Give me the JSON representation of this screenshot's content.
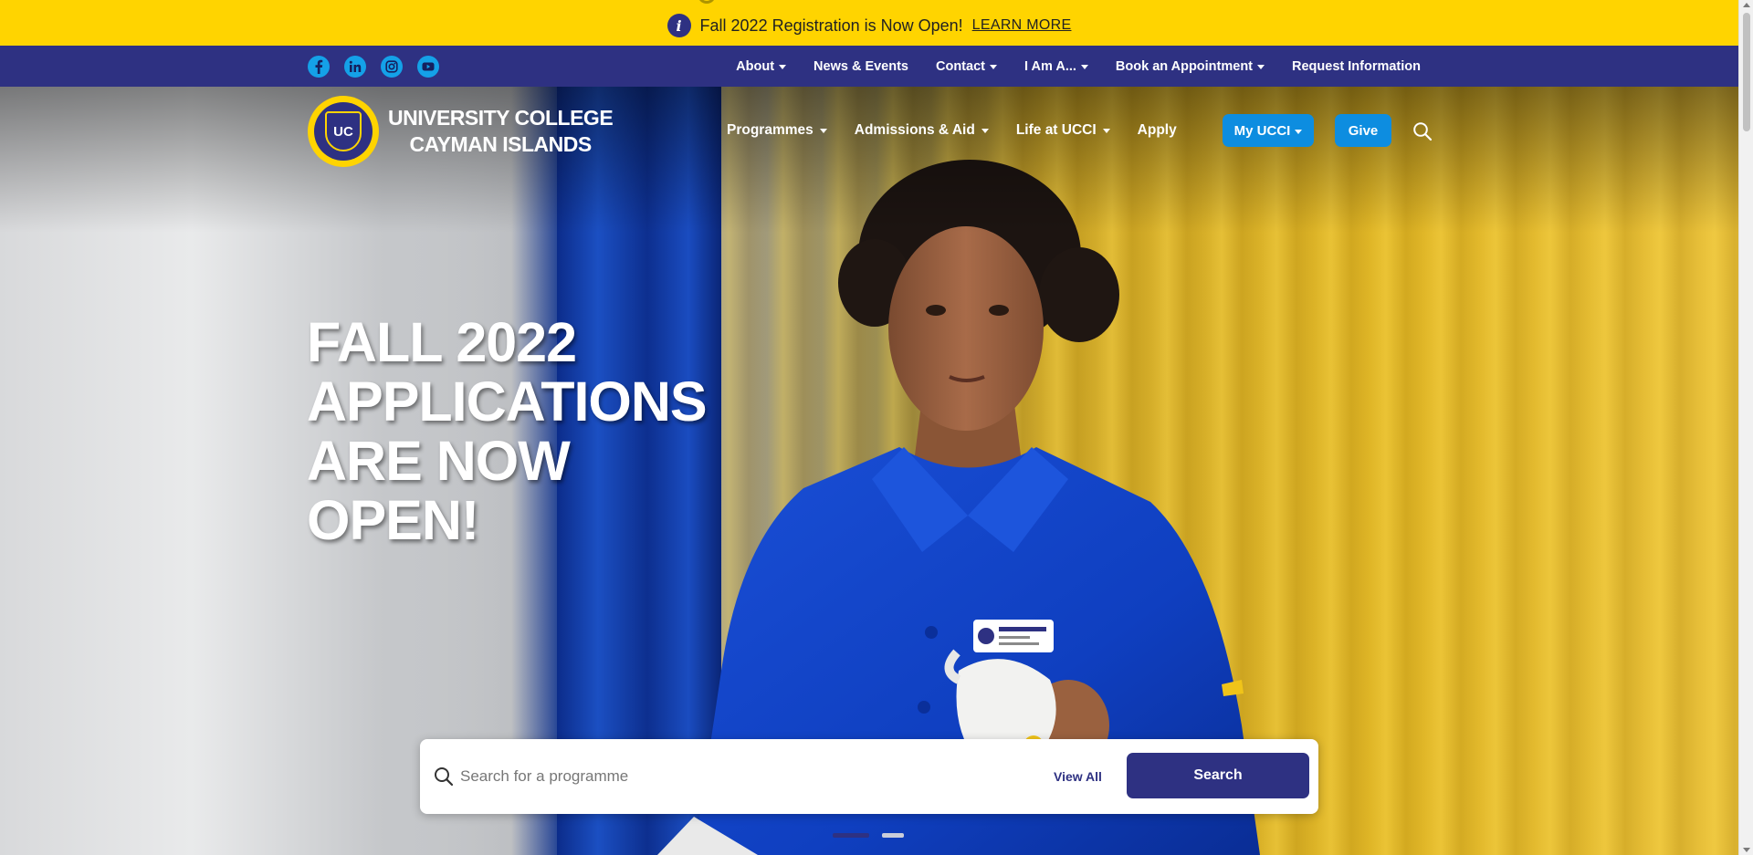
{
  "alert": {
    "icon": "info-icon",
    "text": "Fall 2022 Registration is Now Open!",
    "link": "LEARN MORE"
  },
  "social": [
    {
      "name": "facebook-icon",
      "glyph": "f"
    },
    {
      "name": "linkedin-icon",
      "glyph": "in"
    },
    {
      "name": "instagram-icon",
      "glyph": ""
    },
    {
      "name": "youtube-icon",
      "glyph": ""
    }
  ],
  "utility_nav": {
    "about": "About",
    "news": "News & Events",
    "contact": "Contact",
    "i_am": "I Am A...",
    "book": "Book an Appointment",
    "request": "Request Information"
  },
  "logo": {
    "line1": "UNIVERSITY COLLEGE",
    "line2": "CAYMAN ISLANDS",
    "crest_text": "UC"
  },
  "main_nav": {
    "programmes": "Programmes",
    "admissions": "Admissions & Aid",
    "life": "Life at UCCI",
    "apply": "Apply",
    "my_ucci": "My UCCI",
    "give": "Give"
  },
  "hero": {
    "headline_lines": [
      "FALL 2022",
      "APPLICATIONS",
      "ARE NOW",
      "OPEN!"
    ]
  },
  "search": {
    "placeholder": "Search for a programme",
    "view_all": "View All",
    "button": "Search"
  },
  "carousel": {
    "slides": 2,
    "active": 1
  },
  "colors": {
    "alert_bg": "#ffd400",
    "navy": "#2e3182",
    "accent_blue": "#0d8de0",
    "social_blue": "#14a1e8"
  }
}
